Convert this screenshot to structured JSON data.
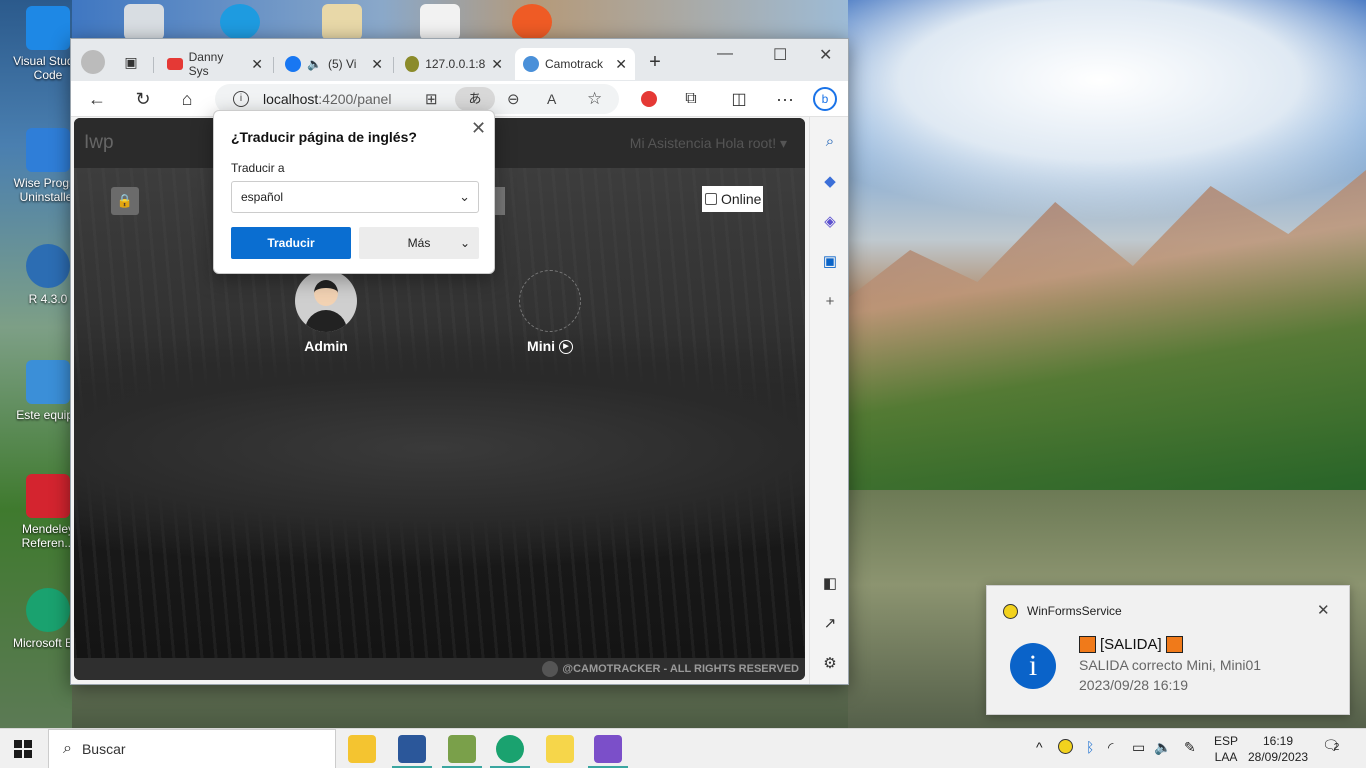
{
  "desktop": {
    "icons": [
      {
        "label": "Visual Studio Code",
        "color": "#1e88e5"
      },
      {
        "label": "Wise Progr... Uninstaller",
        "color": "#2f7ed8"
      },
      {
        "label": "R 4.3.0",
        "color": "#2c6db3"
      },
      {
        "label": "Este equipo",
        "color": "#3b8fd8"
      },
      {
        "label": "Mendeley Referen...",
        "color": "#d4242f"
      },
      {
        "label": "Microsoft E...",
        "color": "#1aa26f"
      }
    ]
  },
  "browser": {
    "tabs": [
      {
        "label": "Danny Sys",
        "icon": "youtube-icon",
        "color": "#e53935"
      },
      {
        "label": "(5) Vi",
        "icon": "facebook-icon",
        "color": "#1877f2"
      },
      {
        "label": "127.0.0.1:8",
        "icon": "app-icon",
        "color": "#8b8b2a"
      },
      {
        "label": "Camotrack",
        "icon": "globe-icon",
        "color": "#4a90d9"
      }
    ],
    "url": {
      "host": "localhost",
      "path": ":4200/panel"
    },
    "translate_badge": "あ"
  },
  "page": {
    "brand": "Iwp",
    "nav_links": "Mi Asistencia    Hola root! ▾",
    "online_label": "Online",
    "users": [
      {
        "name": "Admin"
      },
      {
        "name": "Mini"
      }
    ],
    "footer": "@CAMOTRACKER - ALL RIGHTS RESERVED"
  },
  "translate_popup": {
    "title": "¿Traducir página de inglés?",
    "label": "Traducir a",
    "language": "español",
    "translate_button": "Traducir",
    "more_button": "Más"
  },
  "notification": {
    "app": "WinFormsService",
    "title": "[SALIDA]",
    "message": "SALIDA correcto Mini, Mini01",
    "time": "2023/09/28 16:19",
    "info_glyph": "i"
  },
  "taskbar": {
    "search_placeholder": "Buscar",
    "lang_line1": "ESP",
    "lang_line2": "LAA",
    "time": "16:19",
    "date": "28/09/2023",
    "notification_count": "2"
  },
  "colors": {
    "accent": "#0a6ed1",
    "toast_square": "#f07a1a"
  }
}
